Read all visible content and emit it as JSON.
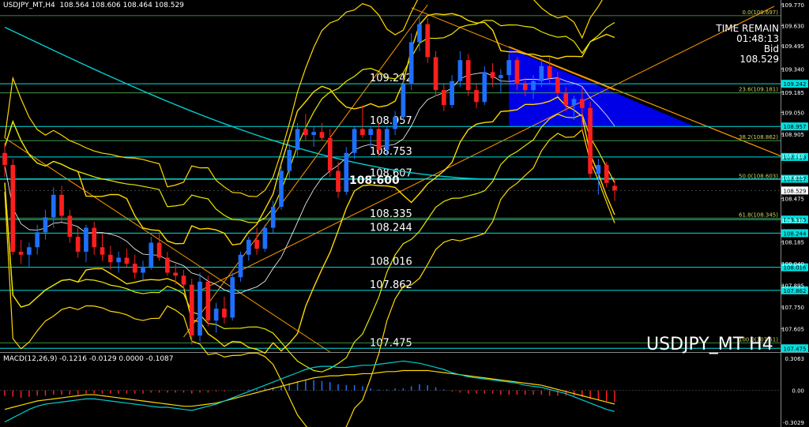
{
  "header": {
    "title": "USDJPY_MT,H4  108.564 108.606 108.464 108.529"
  },
  "info": {
    "line1": "TIME REMAIN",
    "line2": "01:48:13",
    "line3": "Bid",
    "line4": "108.529"
  },
  "symbol_label": "USDJPY_MT H4",
  "macd_header": "MACD(12,26,9) -0.1216 -0.0129 0.0000 -0.1087",
  "colors": {
    "bull": "#1e6fff",
    "bear": "#ff1e1e",
    "boll_outer": "#ffd700",
    "boll_mid": "#e6e600",
    "ma_long": "#00ced1",
    "fib": "#4caf50",
    "level": "#00e0e0",
    "trend": "#ff9900",
    "triangle": "#0000ff"
  },
  "chart_data": [
    {
      "type": "candlestick",
      "ylim": [
        107.45,
        109.77
      ],
      "y_ticks": [
        "109.770",
        "109.630",
        "109.495",
        "109.340",
        "109.185",
        "109.050",
        "108.905",
        "108.760",
        "108.615",
        "108.475",
        "108.330",
        "108.185",
        "108.040",
        "107.895",
        "107.750",
        "107.605"
      ],
      "levels": [
        {
          "label": "109.242",
          "value": 109.242,
          "tag": "109.242"
        },
        {
          "label": "108.957",
          "value": 108.957,
          "tag": "108.957"
        },
        {
          "label": "108.753",
          "value": 108.753,
          "tag": "108.753"
        },
        {
          "label": "108.607",
          "value": 108.607,
          "tag": "108.607"
        },
        {
          "label": "108.335",
          "value": 108.335,
          "tag": "108.335"
        },
        {
          "label": "108.244",
          "value": 108.244,
          "tag": "108.244"
        },
        {
          "label": "108.016",
          "value": 108.016,
          "tag": "108.016"
        },
        {
          "label": "107.862",
          "value": 107.862,
          "tag": "107.862"
        },
        {
          "label": "107.475",
          "value": 107.475,
          "tag": "107.475"
        }
      ],
      "fib": [
        {
          "label": "0.0(109.697)",
          "value": 109.697
        },
        {
          "label": "23.6(109.181)",
          "value": 109.181
        },
        {
          "label": "38.2(108.862)",
          "value": 108.862
        },
        {
          "label": "50.0(108.603)",
          "value": 108.603
        },
        {
          "label": "61.8(108.345)",
          "value": 108.345
        },
        {
          "label": "100.0(107.51)",
          "value": 107.51
        }
      ],
      "price_label": "108.600",
      "price_label_value": 108.6,
      "current": {
        "label": "108.529",
        "value": 108.529
      },
      "candles": [
        [
          108.78,
          108.85,
          108.62,
          108.7
        ],
        [
          108.7,
          108.74,
          108.1,
          108.12
        ],
        [
          108.12,
          108.2,
          108.04,
          108.1
        ],
        [
          108.1,
          108.18,
          108.02,
          108.15
        ],
        [
          108.15,
          108.3,
          108.1,
          108.25
        ],
        [
          108.25,
          108.4,
          108.2,
          108.35
        ],
        [
          108.35,
          108.55,
          108.28,
          108.5
        ],
        [
          108.5,
          108.56,
          108.32,
          108.36
        ],
        [
          108.36,
          108.4,
          108.18,
          108.22
        ],
        [
          108.22,
          108.28,
          108.08,
          108.12
        ],
        [
          108.12,
          108.3,
          108.05,
          108.28
        ],
        [
          108.28,
          108.32,
          108.1,
          108.15
        ],
        [
          108.15,
          108.24,
          108.06,
          108.1
        ],
        [
          108.1,
          108.16,
          108.0,
          108.05
        ],
        [
          108.05,
          108.12,
          107.98,
          108.08
        ],
        [
          108.08,
          108.14,
          108.02,
          108.04
        ],
        [
          108.04,
          108.1,
          107.94,
          107.98
        ],
        [
          107.98,
          108.06,
          107.92,
          108.02
        ],
        [
          108.02,
          108.22,
          108.0,
          108.18
        ],
        [
          108.18,
          108.24,
          108.06,
          108.08
        ],
        [
          108.08,
          108.12,
          107.96,
          107.98
        ],
        [
          107.98,
          108.04,
          107.9,
          107.96
        ],
        [
          107.96,
          108.0,
          107.86,
          107.9
        ],
        [
          107.9,
          107.94,
          107.5,
          107.56
        ],
        [
          107.56,
          107.98,
          107.52,
          107.92
        ],
        [
          107.92,
          107.96,
          107.62,
          107.66
        ],
        [
          107.66,
          107.78,
          107.58,
          107.74
        ],
        [
          107.74,
          107.82,
          107.64,
          107.68
        ],
        [
          107.68,
          107.98,
          107.66,
          107.95
        ],
        [
          107.95,
          108.12,
          107.92,
          108.1
        ],
        [
          108.1,
          108.22,
          108.06,
          108.2
        ],
        [
          108.2,
          108.28,
          108.1,
          108.14
        ],
        [
          108.14,
          108.3,
          108.12,
          108.28
        ],
        [
          108.28,
          108.46,
          108.24,
          108.42
        ],
        [
          108.42,
          108.7,
          108.4,
          108.66
        ],
        [
          108.66,
          108.84,
          108.6,
          108.8
        ],
        [
          108.8,
          108.98,
          108.76,
          108.94
        ],
        [
          108.94,
          109.04,
          108.86,
          108.9
        ],
        [
          108.9,
          108.96,
          108.82,
          108.92
        ],
        [
          108.92,
          108.98,
          108.86,
          108.88
        ],
        [
          108.88,
          108.94,
          108.62,
          108.66
        ],
        [
          108.66,
          108.72,
          108.48,
          108.52
        ],
        [
          108.52,
          108.82,
          108.5,
          108.78
        ],
        [
          108.78,
          108.96,
          108.74,
          108.94
        ],
        [
          108.94,
          109.1,
          108.88,
          108.9
        ],
        [
          108.9,
          108.96,
          108.82,
          108.94
        ],
        [
          108.94,
          108.98,
          108.76,
          108.8
        ],
        [
          108.8,
          108.96,
          108.76,
          108.94
        ],
        [
          108.94,
          109.06,
          108.9,
          109.02
        ],
        [
          109.02,
          109.28,
          109.0,
          109.24
        ],
        [
          109.24,
          109.58,
          109.2,
          109.52
        ],
        [
          109.52,
          109.7,
          109.46,
          109.64
        ],
        [
          109.64,
          109.68,
          109.38,
          109.42
        ],
        [
          109.42,
          109.46,
          109.16,
          109.2
        ],
        [
          109.2,
          109.24,
          109.06,
          109.1
        ],
        [
          109.1,
          109.3,
          109.08,
          109.26
        ],
        [
          109.26,
          109.46,
          109.22,
          109.4
        ],
        [
          109.4,
          109.44,
          109.16,
          109.2
        ],
        [
          109.2,
          109.24,
          109.08,
          109.12
        ],
        [
          109.12,
          109.36,
          109.1,
          109.32
        ],
        [
          109.32,
          109.38,
          109.22,
          109.28
        ],
        [
          109.28,
          109.34,
          109.18,
          109.3
        ],
        [
          109.3,
          109.44,
          109.26,
          109.4
        ],
        [
          109.4,
          109.42,
          109.2,
          109.24
        ],
        [
          109.24,
          109.28,
          109.16,
          109.2
        ],
        [
          109.2,
          109.3,
          109.14,
          109.26
        ],
        [
          109.26,
          109.4,
          109.22,
          109.36
        ],
        [
          109.36,
          109.42,
          109.24,
          109.28
        ],
        [
          109.28,
          109.32,
          109.16,
          109.18
        ],
        [
          109.18,
          109.22,
          109.06,
          109.1
        ],
        [
          109.1,
          109.16,
          109.0,
          109.14
        ],
        [
          109.14,
          109.22,
          108.92,
          109.08
        ],
        [
          109.08,
          109.12,
          108.6,
          108.64
        ],
        [
          108.64,
          108.74,
          108.5,
          108.7
        ],
        [
          108.7,
          108.72,
          108.55,
          108.58
        ],
        [
          108.56,
          108.61,
          108.46,
          108.53
        ]
      ],
      "macd_ylim": [
        -0.3029,
        0.3063
      ],
      "macd_ticks": [
        "0.3063",
        "0.00",
        "-0.3029"
      ],
      "macd_hist": [
        -0.05,
        -0.06,
        -0.07,
        -0.06,
        -0.05,
        -0.05,
        -0.04,
        -0.04,
        -0.04,
        -0.04,
        -0.03,
        -0.03,
        -0.03,
        -0.03,
        -0.03,
        -0.03,
        -0.03,
        -0.03,
        -0.02,
        -0.02,
        -0.02,
        -0.02,
        -0.02,
        -0.03,
        -0.02,
        -0.02,
        -0.01,
        -0.01,
        0.0,
        0.0,
        0.01,
        0.01,
        0.02,
        0.03,
        0.05,
        0.07,
        0.09,
        0.1,
        0.1,
        0.09,
        0.08,
        0.06,
        0.05,
        0.05,
        0.04,
        0.02,
        0.01,
        0.01,
        0.02,
        0.02,
        0.04,
        0.06,
        0.05,
        0.03,
        0.01,
        -0.01,
        -0.02,
        -0.03,
        -0.03,
        -0.03,
        -0.03,
        -0.04,
        -0.04,
        -0.04,
        -0.04,
        -0.04,
        -0.04,
        -0.05,
        -0.05,
        -0.05,
        -0.05,
        -0.06,
        -0.08,
        -0.09,
        -0.1,
        -0.11
      ],
      "macd_signal": [
        -0.18,
        -0.16,
        -0.14,
        -0.12,
        -0.1,
        -0.09,
        -0.08,
        -0.07,
        -0.06,
        -0.05,
        -0.04,
        -0.04,
        -0.05,
        -0.06,
        -0.07,
        -0.08,
        -0.09,
        -0.1,
        -0.11,
        -0.12,
        -0.13,
        -0.14,
        -0.15,
        -0.15,
        -0.14,
        -0.13,
        -0.12,
        -0.1,
        -0.08,
        -0.06,
        -0.04,
        -0.02,
        0.0,
        0.02,
        0.04,
        0.06,
        0.08,
        0.1,
        0.12,
        0.13,
        0.14,
        0.14,
        0.15,
        0.15,
        0.16,
        0.16,
        0.17,
        0.18,
        0.18,
        0.19,
        0.19,
        0.19,
        0.19,
        0.18,
        0.17,
        0.16,
        0.15,
        0.14,
        0.13,
        0.12,
        0.11,
        0.1,
        0.09,
        0.08,
        0.07,
        0.06,
        0.05,
        0.03,
        0.01,
        -0.01,
        -0.03,
        -0.05,
        -0.07,
        -0.09,
        -0.11,
        -0.13
      ],
      "macd_main": [
        -0.3,
        -0.26,
        -0.22,
        -0.18,
        -0.15,
        -0.13,
        -0.12,
        -0.11,
        -0.1,
        -0.09,
        -0.08,
        -0.08,
        -0.09,
        -0.1,
        -0.11,
        -0.12,
        -0.13,
        -0.14,
        -0.15,
        -0.16,
        -0.16,
        -0.17,
        -0.18,
        -0.19,
        -0.17,
        -0.15,
        -0.13,
        -0.1,
        -0.07,
        -0.04,
        -0.01,
        0.02,
        0.05,
        0.08,
        0.11,
        0.14,
        0.17,
        0.2,
        0.22,
        0.23,
        0.23,
        0.22,
        0.22,
        0.23,
        0.24,
        0.24,
        0.25,
        0.26,
        0.27,
        0.28,
        0.27,
        0.26,
        0.24,
        0.22,
        0.2,
        0.17,
        0.15,
        0.13,
        0.12,
        0.11,
        0.1,
        0.09,
        0.08,
        0.07,
        0.05,
        0.04,
        0.03,
        0.01,
        -0.01,
        -0.03,
        -0.06,
        -0.09,
        -0.12,
        -0.15,
        -0.18,
        -0.2
      ]
    }
  ]
}
